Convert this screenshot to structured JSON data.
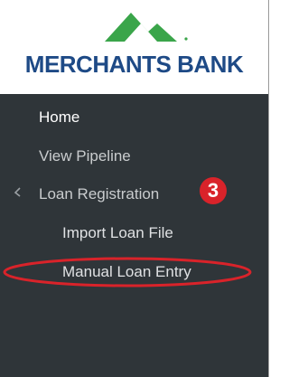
{
  "brand": {
    "name": "MERCHANTS BANK",
    "color": "#1e4a86",
    "accent": "#3aa54a"
  },
  "sidebar": {
    "background": "#2f3539",
    "items": [
      {
        "label": "Home",
        "state": "active"
      },
      {
        "label": "View Pipeline"
      },
      {
        "label": "Loan Registration",
        "expanded": true,
        "icon": "chevron-icon"
      },
      {
        "label": "Import Loan File",
        "submenu": true
      },
      {
        "label": "Manual Loan Entry",
        "submenu": true,
        "highlighted": true
      }
    ]
  },
  "annotation": {
    "step_number": "3",
    "color": "#d9232a"
  }
}
